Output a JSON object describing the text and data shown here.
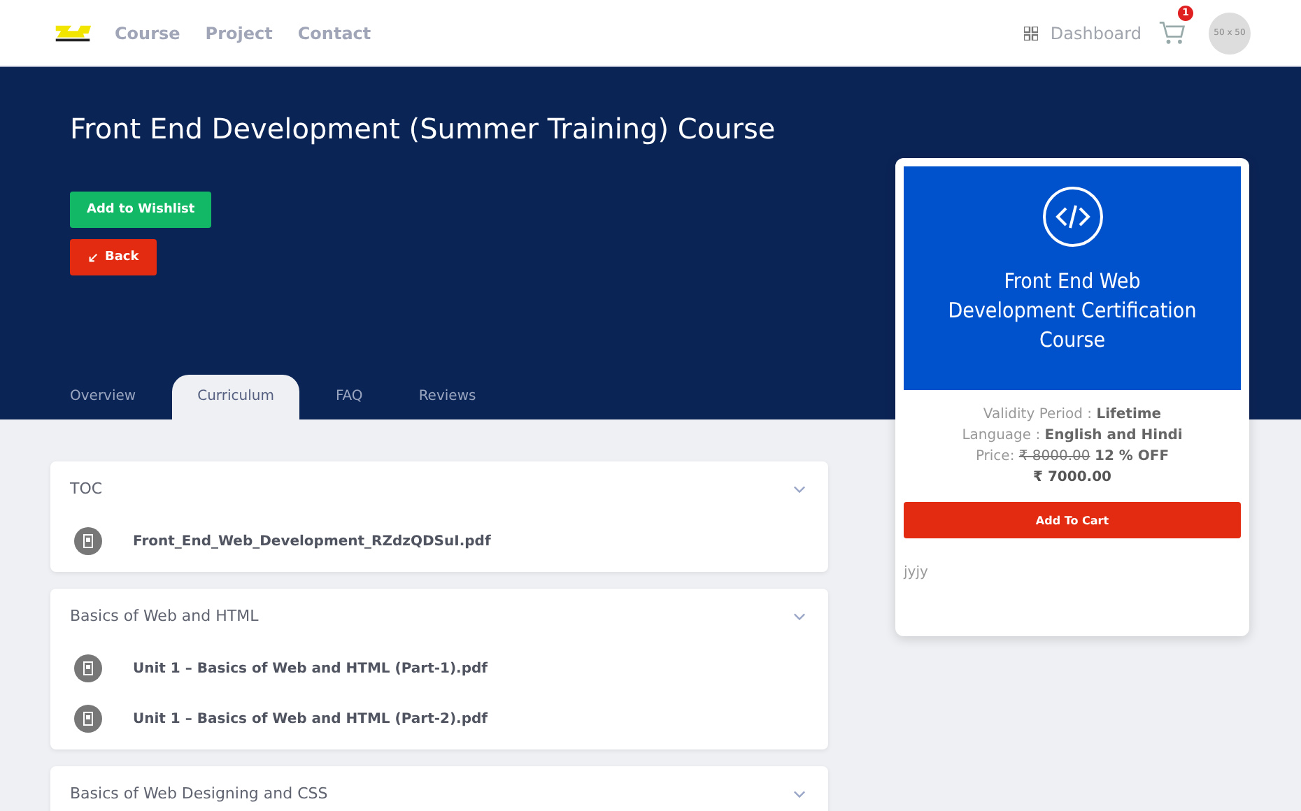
{
  "nav": {
    "links": [
      {
        "label": "Course"
      },
      {
        "label": "Project"
      },
      {
        "label": "Contact"
      }
    ],
    "dashboard": "Dashboard",
    "cart_count": "1",
    "avatar": "50 x 50"
  },
  "hero": {
    "title": "Front End Development (Summer Training) Course",
    "buttons": [
      {
        "kind": "wishlist",
        "label": "Add to Wishlist"
      },
      {
        "kind": "back",
        "label": "Back"
      }
    ]
  },
  "tabs": [
    {
      "label": "Overview",
      "selected": false
    },
    {
      "label": "Curriculum",
      "selected": true
    },
    {
      "label": "FAQ",
      "selected": false
    },
    {
      "label": "Reviews",
      "selected": false
    }
  ],
  "sections": [
    {
      "title": "TOC",
      "files": [
        "Front_End_Web_Development_RZdzQDSuI.pdf"
      ]
    },
    {
      "title": "Basics of Web and HTML",
      "files": [
        "Unit 1 – Basics of Web and HTML (Part-1).pdf",
        "Unit 1 – Basics of Web and HTML (Part-2).pdf"
      ]
    },
    {
      "title": "Basics of Web Designing and CSS"
    }
  ],
  "card": {
    "banner_title": "Front End Web Development Certification Course",
    "details": [
      {
        "label": "Validity Period : ",
        "value": "Lifetime"
      },
      {
        "label": "Language : ",
        "value": "English and Hindi"
      }
    ],
    "price_label": "Price: ",
    "old_price": "₹ 8000.00",
    "discount": "12 % OFF",
    "price": "₹ 7000.00",
    "button": "Add To Cart",
    "note": "jyjy"
  }
}
